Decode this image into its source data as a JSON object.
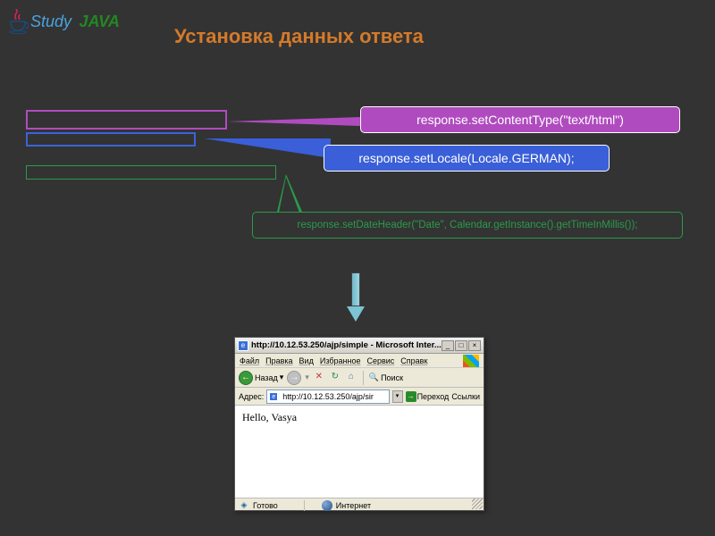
{
  "logo": {
    "text1": "Study",
    "text2": "JAVA"
  },
  "title": "Установка данных ответа",
  "callouts": {
    "purple": "response.setContentType(\"text/html\")",
    "blue": "response.setLocale(Locale.GERMAN);",
    "green": "response.setDateHeader(\"Date\", Calendar.getInstance().getTimeInMillis());"
  },
  "browser": {
    "titlebar": "http://10.12.53.250/ajp/simple - Microsoft Inter...",
    "menu": {
      "file": "Файл",
      "edit": "Правка",
      "view": "Вид",
      "favorites": "Избранное",
      "tools": "Сервис",
      "help": "Справк"
    },
    "toolbar": {
      "back": "Назад",
      "search": "Поиск"
    },
    "address": {
      "label": "Адрес:",
      "url": "http://10.12.53.250/ajp/sir",
      "go": "Переход",
      "links": "Ссылки"
    },
    "content": "Hello, Vasya",
    "status": {
      "ready": "Готово",
      "zone": "Интернет"
    }
  }
}
